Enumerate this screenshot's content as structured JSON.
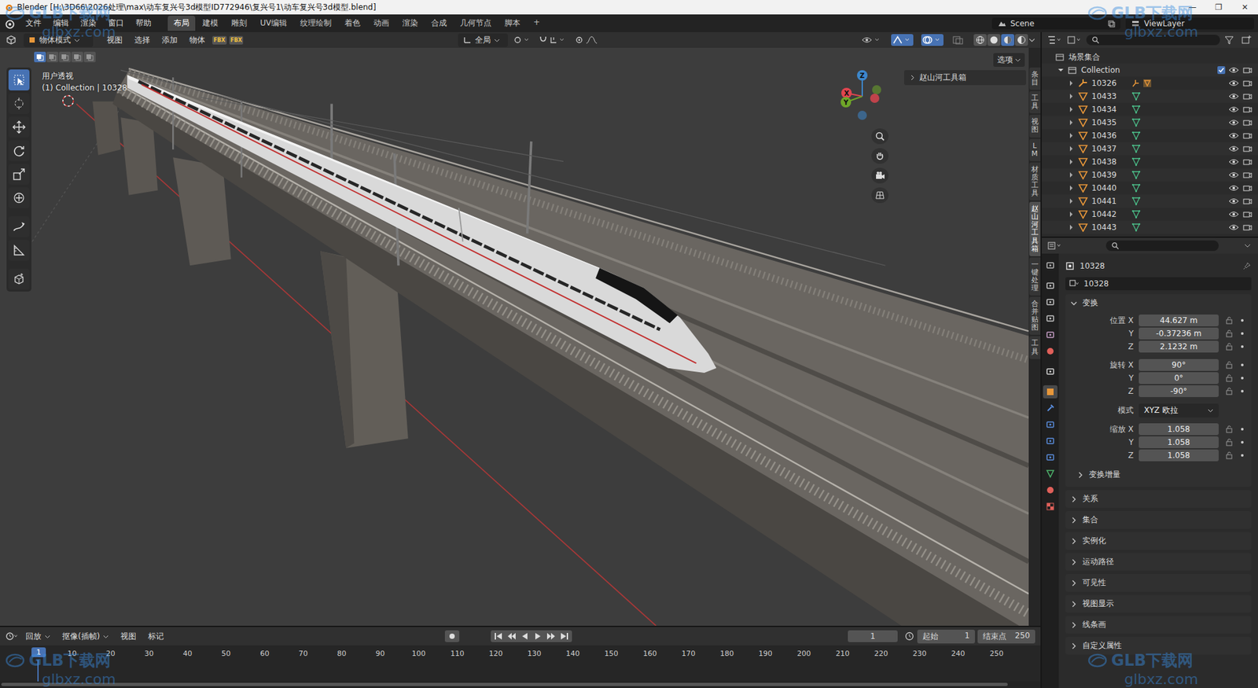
{
  "window": {
    "title": "Blender [H:\\3D66\\2026处理\\max\\动车复兴号3d模型ID772946\\复兴号1\\动车复兴号3d模型.blend]",
    "controls": [
      "—",
      "❐",
      "✕"
    ]
  },
  "watermarks": [
    {
      "brand": "GLB下载网",
      "url": "glbxz.com"
    },
    {
      "brand": "GLB下载网",
      "url": "glbxz.com"
    },
    {
      "brand": "GLB下载网",
      "url": "glbxz.com"
    },
    {
      "brand": "GLB下载网",
      "url": "glbxz.com"
    }
  ],
  "menu": [
    "文件",
    "编辑",
    "渲染",
    "窗口",
    "帮助"
  ],
  "workspaces": [
    {
      "label": "布局",
      "selected": true
    },
    {
      "label": "建模",
      "selected": false
    },
    {
      "label": "雕刻",
      "selected": false
    },
    {
      "label": "UV编辑",
      "selected": false
    },
    {
      "label": "纹理绘制",
      "selected": false
    },
    {
      "label": "着色",
      "selected": false
    },
    {
      "label": "动画",
      "selected": false
    },
    {
      "label": "渲染",
      "selected": false
    },
    {
      "label": "合成",
      "selected": false
    },
    {
      "label": "几何节点",
      "selected": false
    },
    {
      "label": "脚本",
      "selected": false
    }
  ],
  "add_workspace": "+",
  "scene": "Scene",
  "view_layer": "ViewLayer",
  "viewport": {
    "mode": "物体模式",
    "menus": [
      "视图",
      "选择",
      "添加",
      "物体"
    ],
    "addon_buttons": [
      "FBX",
      "FBX"
    ],
    "orientation": "全局",
    "options": "选项",
    "view_name": "用户透视",
    "context": "(1) Collection | 10328",
    "axes": [
      {
        "label": "X",
        "color": "#e0454f"
      },
      {
        "label": "Y",
        "color": "#6ea529"
      },
      {
        "label": "Z",
        "color": "#3d87cc"
      }
    ],
    "select_modes": [
      {
        "kind": "new",
        "selected": true
      },
      {
        "kind": "extend",
        "selected": false
      },
      {
        "kind": "subtract",
        "selected": false
      },
      {
        "kind": "invert",
        "selected": false
      },
      {
        "kind": "intersect",
        "selected": false
      }
    ],
    "shading": [
      {
        "kind": "wireframe",
        "selected": false
      },
      {
        "kind": "solid",
        "selected": false
      },
      {
        "kind": "material",
        "selected": true
      },
      {
        "kind": "rendered",
        "selected": false
      }
    ],
    "panel": "赵山河工具箱",
    "side_tabs": [
      {
        "label": "条目",
        "selected": false
      },
      {
        "label": "工具",
        "selected": false
      },
      {
        "label": "视图",
        "selected": false
      },
      {
        "label": "LM",
        "selected": false
      },
      {
        "label": "材质工具",
        "selected": false
      },
      {
        "label": "赵山河工具箱",
        "selected": true
      },
      {
        "label": "一键处理",
        "selected": false
      },
      {
        "label": "合并贴图",
        "selected": false
      },
      {
        "label": "工具",
        "selected": false
      }
    ]
  },
  "tools": [
    {
      "kind": "select",
      "selected": true
    },
    {
      "kind": "cursor",
      "selected": false
    },
    {
      "kind": "move",
      "selected": false
    },
    {
      "kind": "rotate",
      "selected": false
    },
    {
      "kind": "scale",
      "selected": false
    },
    {
      "kind": "transform",
      "selected": false
    },
    {
      "kind": "annotate",
      "selected": false
    },
    {
      "kind": "measure",
      "selected": false
    },
    {
      "kind": "add-cube",
      "selected": false
    }
  ],
  "outliner": {
    "root": "场景集合",
    "collection": {
      "label": "Collection",
      "checked": true
    },
    "items": [
      {
        "label": "10326",
        "kind": "armature",
        "visible": true
      },
      {
        "label": "10433",
        "kind": "mesh",
        "visible": true
      },
      {
        "label": "10434",
        "kind": "mesh",
        "visible": true
      },
      {
        "label": "10435",
        "kind": "mesh",
        "visible": true
      },
      {
        "label": "10436",
        "kind": "mesh",
        "visible": true
      },
      {
        "label": "10437",
        "kind": "mesh",
        "visible": true
      },
      {
        "label": "10438",
        "kind": "mesh",
        "visible": true
      },
      {
        "label": "10439",
        "kind": "mesh",
        "visible": true
      },
      {
        "label": "10440",
        "kind": "mesh",
        "visible": true
      },
      {
        "label": "10441",
        "kind": "mesh",
        "visible": true
      },
      {
        "label": "10442",
        "kind": "mesh",
        "visible": true
      },
      {
        "label": "10443",
        "kind": "mesh",
        "visible": true
      }
    ]
  },
  "properties": {
    "tabs": [
      {
        "kind": "tool",
        "selected": false,
        "color": "#b8b8b8"
      },
      {
        "kind": "render",
        "selected": false,
        "color": "#c8c8c8"
      },
      {
        "kind": "output",
        "selected": false,
        "color": "#c8c8c8"
      },
      {
        "kind": "view-layer",
        "selected": false,
        "color": "#c8c8c8"
      },
      {
        "kind": "scene",
        "selected": false,
        "color": "#c8a0c8"
      },
      {
        "kind": "world",
        "selected": false,
        "color": "#e0605a"
      },
      {
        "kind": "collection",
        "selected": false,
        "color": "#d8d8d8"
      },
      {
        "kind": "object",
        "selected": true,
        "color": "#e8973a"
      },
      {
        "kind": "modifiers",
        "selected": false,
        "color": "#5b8fe0"
      },
      {
        "kind": "particles",
        "selected": false,
        "color": "#5b8fe0"
      },
      {
        "kind": "physics",
        "selected": false,
        "color": "#5b8fe0"
      },
      {
        "kind": "constraints",
        "selected": false,
        "color": "#5b8fe0"
      },
      {
        "kind": "data",
        "selected": false,
        "color": "#4cb06a"
      },
      {
        "kind": "material",
        "selected": false,
        "color": "#e0605a"
      },
      {
        "kind": "texture",
        "selected": false,
        "color": "#e0605a"
      }
    ],
    "object": "10328",
    "data_name": "10328",
    "section": "变换",
    "rows": [
      {
        "kind": "vector",
        "fields": [
          {
            "label": "位置 X",
            "value": "44.627 m"
          },
          {
            "label": "Y",
            "value": "-0.37236 m"
          },
          {
            "label": "Z",
            "value": "2.1232 m"
          }
        ]
      },
      {
        "kind": "vector",
        "fields": [
          {
            "label": "旋转 X",
            "value": "90°"
          },
          {
            "label": "Y",
            "value": "0°"
          },
          {
            "label": "Z",
            "value": "-90°"
          }
        ]
      },
      {
        "kind": "enum",
        "fields": [
          {
            "label": "模式",
            "value": "XYZ 欧拉"
          }
        ]
      },
      {
        "kind": "vector",
        "fields": [
          {
            "label": "缩放 X",
            "value": "1.058"
          },
          {
            "label": "Y",
            "value": "1.058"
          },
          {
            "label": "Z",
            "value": "1.058"
          }
        ]
      }
    ],
    "subsection": "变换增量",
    "collapsed": [
      "关系",
      "集合",
      "实例化",
      "运动路径",
      "可见性",
      "视图显示",
      "线条画",
      "自定义属性"
    ]
  },
  "timeline": {
    "menus": [
      "回放",
      "抠像(插帧)",
      "视图",
      "标记"
    ],
    "current": "1",
    "start_label": "起始",
    "start": "1",
    "end_label": "结束点",
    "end": "250",
    "ticks": [
      "10",
      "20",
      "30",
      "40",
      "50",
      "60",
      "70",
      "80",
      "90",
      "100",
      "110",
      "120",
      "130",
      "140",
      "150",
      "160",
      "170",
      "180",
      "190",
      "200",
      "210",
      "220",
      "230",
      "240",
      "250"
    ]
  }
}
